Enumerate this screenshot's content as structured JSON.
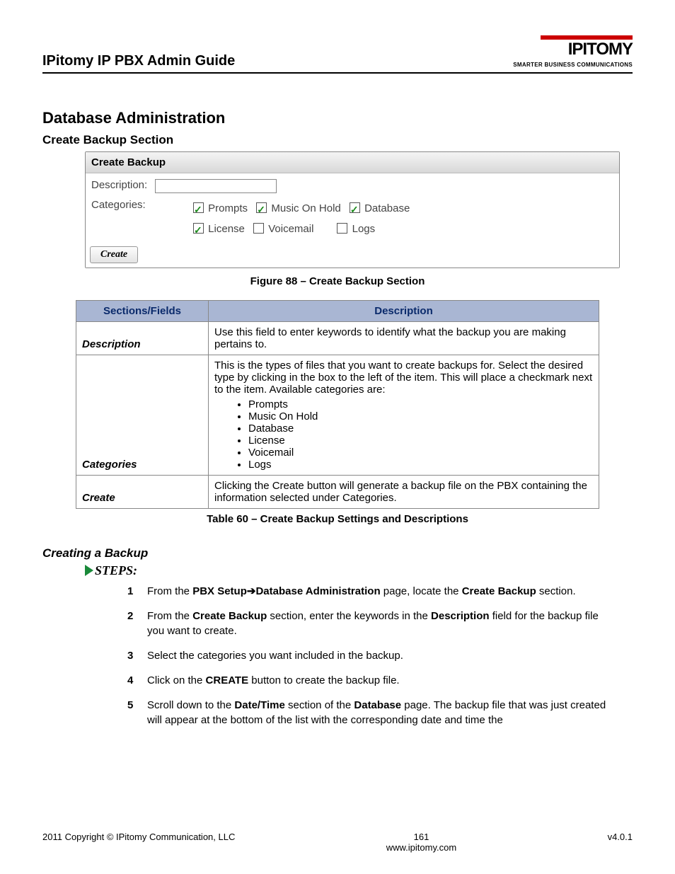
{
  "header": {
    "guide_title": "IPitomy IP PBX Admin Guide",
    "logo_main": "IPITOMY",
    "logo_tag": "SMARTER BUSINESS COMMUNICATIONS"
  },
  "section_title": "Database Administration",
  "subsection_title": "Create Backup Section",
  "screenshot": {
    "panel_title": "Create Backup",
    "description_label": "Description:",
    "categories_label": "Categories:",
    "categories": [
      {
        "label": "Prompts",
        "checked": true
      },
      {
        "label": "Music On Hold",
        "checked": true
      },
      {
        "label": "Database",
        "checked": true
      },
      {
        "label": "License",
        "checked": true
      },
      {
        "label": "Voicemail",
        "checked": false
      },
      {
        "label": "Logs",
        "checked": false
      }
    ],
    "create_button": "Create"
  },
  "figure_caption": "Figure 88 – Create Backup Section",
  "spec_table": {
    "headers": [
      "Sections/Fields",
      "Description"
    ],
    "rows": [
      {
        "field": "Description",
        "desc": "Use this field to enter keywords to identify what the backup you are making pertains to."
      },
      {
        "field": "Categories",
        "desc_intro": "This is the types of files that you want to create backups for. Select the desired type by clicking in the box to the left of the item. This will place a checkmark next to the item. Available categories are:",
        "list": [
          "Prompts",
          "Music On Hold",
          "Database",
          "License",
          "Voicemail",
          "Logs"
        ]
      },
      {
        "field": "Create",
        "desc": "Clicking the Create button will generate a backup file on the PBX containing the information selected under Categories."
      }
    ]
  },
  "table_caption": "Table 60 – Create Backup Settings and Descriptions",
  "procedure_title": "Creating a Backup",
  "steps_label": "STEPS:",
  "steps": [
    {
      "pre": "From the ",
      "b1": "PBX Setup",
      "arrow": "➔",
      "b2": "Database Administration",
      "mid": " page, locate the ",
      "b3": "Create Backup",
      "post": " section."
    },
    {
      "pre": "From the ",
      "b1": "Create Backup",
      "mid": " section, enter the keywords in the ",
      "b2": "Description",
      "post": " field for the backup file you want to create."
    },
    {
      "text": "Select the categories you want included in the backup."
    },
    {
      "pre": "Click on the ",
      "b1": "CREATE",
      "post": " button to create the backup file."
    },
    {
      "pre": "Scroll down to the ",
      "b1": "Date/Time",
      "mid": " section of the ",
      "b2": "Database",
      "post": " page. The backup file that was just created will appear at the bottom of the list with the corresponding date and time the"
    }
  ],
  "footer": {
    "left": "2011 Copyright © IPitomy Communication, LLC",
    "page": "161",
    "url": "www.ipitomy.com",
    "right": "v4.0.1"
  }
}
